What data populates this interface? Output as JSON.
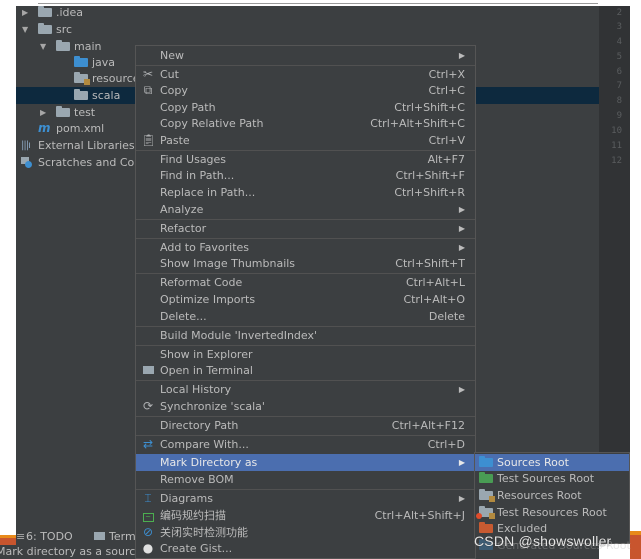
{
  "project_tree": {
    "items": [
      {
        "label": ".idea",
        "expanded": false,
        "level": 0,
        "icon": "folder-icon"
      },
      {
        "label": "src",
        "expanded": true,
        "level": 0,
        "icon": "folder-icon"
      },
      {
        "label": "main",
        "expanded": true,
        "level": 1,
        "icon": "folder-icon"
      },
      {
        "label": "java",
        "level": 2,
        "icon": "source-folder-icon"
      },
      {
        "label": "resources",
        "level": 2,
        "icon": "resources-folder-icon"
      },
      {
        "label": "scala",
        "level": 2,
        "icon": "folder-icon",
        "selected": true
      },
      {
        "label": "test",
        "expanded": false,
        "level": 1,
        "icon": "folder-icon"
      },
      {
        "label": "pom.xml",
        "level": 0,
        "icon": "maven-icon"
      },
      {
        "label": "External Libraries",
        "level": -1,
        "icon": "libraries-icon"
      },
      {
        "label": "Scratches and Consoles",
        "level": -1,
        "icon": "scratches-icon"
      }
    ]
  },
  "gutter": {
    "line_numbers": [
      "2",
      "3",
      "4",
      "5",
      "6",
      "7",
      "8",
      "9",
      "10",
      "11",
      "12"
    ]
  },
  "bottom_toolbar": {
    "todo": "6: TODO",
    "terminal": "Terminal"
  },
  "status_bar": {
    "text": "Mark directory as a source root"
  },
  "context_menu": {
    "items": [
      {
        "label": "New",
        "submenu": true
      },
      {
        "label": "Cut",
        "shortcut": "Ctrl+X",
        "icon": "scissors-icon"
      },
      {
        "label": "Copy",
        "shortcut": "Ctrl+C",
        "icon": "copy-icon"
      },
      {
        "label": "Copy Path",
        "shortcut": "Ctrl+Shift+C"
      },
      {
        "label": "Copy Relative Path",
        "shortcut": "Ctrl+Alt+Shift+C"
      },
      {
        "label": "Paste",
        "shortcut": "Ctrl+V",
        "icon": "clipboard-icon"
      },
      {
        "label": "Find Usages",
        "shortcut": "Alt+F7"
      },
      {
        "label": "Find in Path...",
        "shortcut": "Ctrl+Shift+F"
      },
      {
        "label": "Replace in Path...",
        "shortcut": "Ctrl+Shift+R"
      },
      {
        "label": "Analyze",
        "submenu": true
      },
      {
        "label": "Refactor",
        "submenu": true
      },
      {
        "label": "Add to Favorites",
        "submenu": true
      },
      {
        "label": "Show Image Thumbnails",
        "shortcut": "Ctrl+Shift+T"
      },
      {
        "label": "Reformat Code",
        "shortcut": "Ctrl+Alt+L"
      },
      {
        "label": "Optimize Imports",
        "shortcut": "Ctrl+Alt+O"
      },
      {
        "label": "Delete...",
        "shortcut": "Delete"
      },
      {
        "label": "Build Module 'InvertedIndex'"
      },
      {
        "label": "Show in Explorer"
      },
      {
        "label": "Open in Terminal",
        "icon": "terminal-icon"
      },
      {
        "label": "Local History",
        "submenu": true
      },
      {
        "label": "Synchronize 'scala'",
        "icon": "sync-icon"
      },
      {
        "label": "Directory Path",
        "shortcut": "Ctrl+Alt+F12"
      },
      {
        "label": "Compare With...",
        "shortcut": "Ctrl+D",
        "icon": "compare-icon"
      },
      {
        "label": "Mark Directory as",
        "submenu": true,
        "active": true
      },
      {
        "label": "Remove BOM"
      },
      {
        "label": "Diagrams",
        "submenu": true,
        "icon": "diagram-icon"
      },
      {
        "label": "编码规约扫描",
        "shortcut": "Ctrl+Alt+Shift+J",
        "icon": "code-scan-icon"
      },
      {
        "label": "关闭实时检测功能",
        "icon": "disable-icon"
      },
      {
        "label": "Create Gist...",
        "icon": "github-icon"
      }
    ]
  },
  "mark_directory_submenu": {
    "items": [
      {
        "label": "Sources Root",
        "active": true
      },
      {
        "label": "Test Sources Root"
      },
      {
        "label": "Resources Root"
      },
      {
        "label": "Test Resources Root"
      },
      {
        "label": "Excluded"
      },
      {
        "label": "Generated Sources Root"
      }
    ]
  },
  "watermark": "CSDN @showswoller",
  "colors": {
    "background": "#3c3f41",
    "selection": "#4b6eaf",
    "tree_selection": "#0d293e",
    "text": "#bbbbbb",
    "source_folder": "#3d8fd1",
    "test_folder": "#499c54",
    "excluded_folder": "#c75a31"
  }
}
